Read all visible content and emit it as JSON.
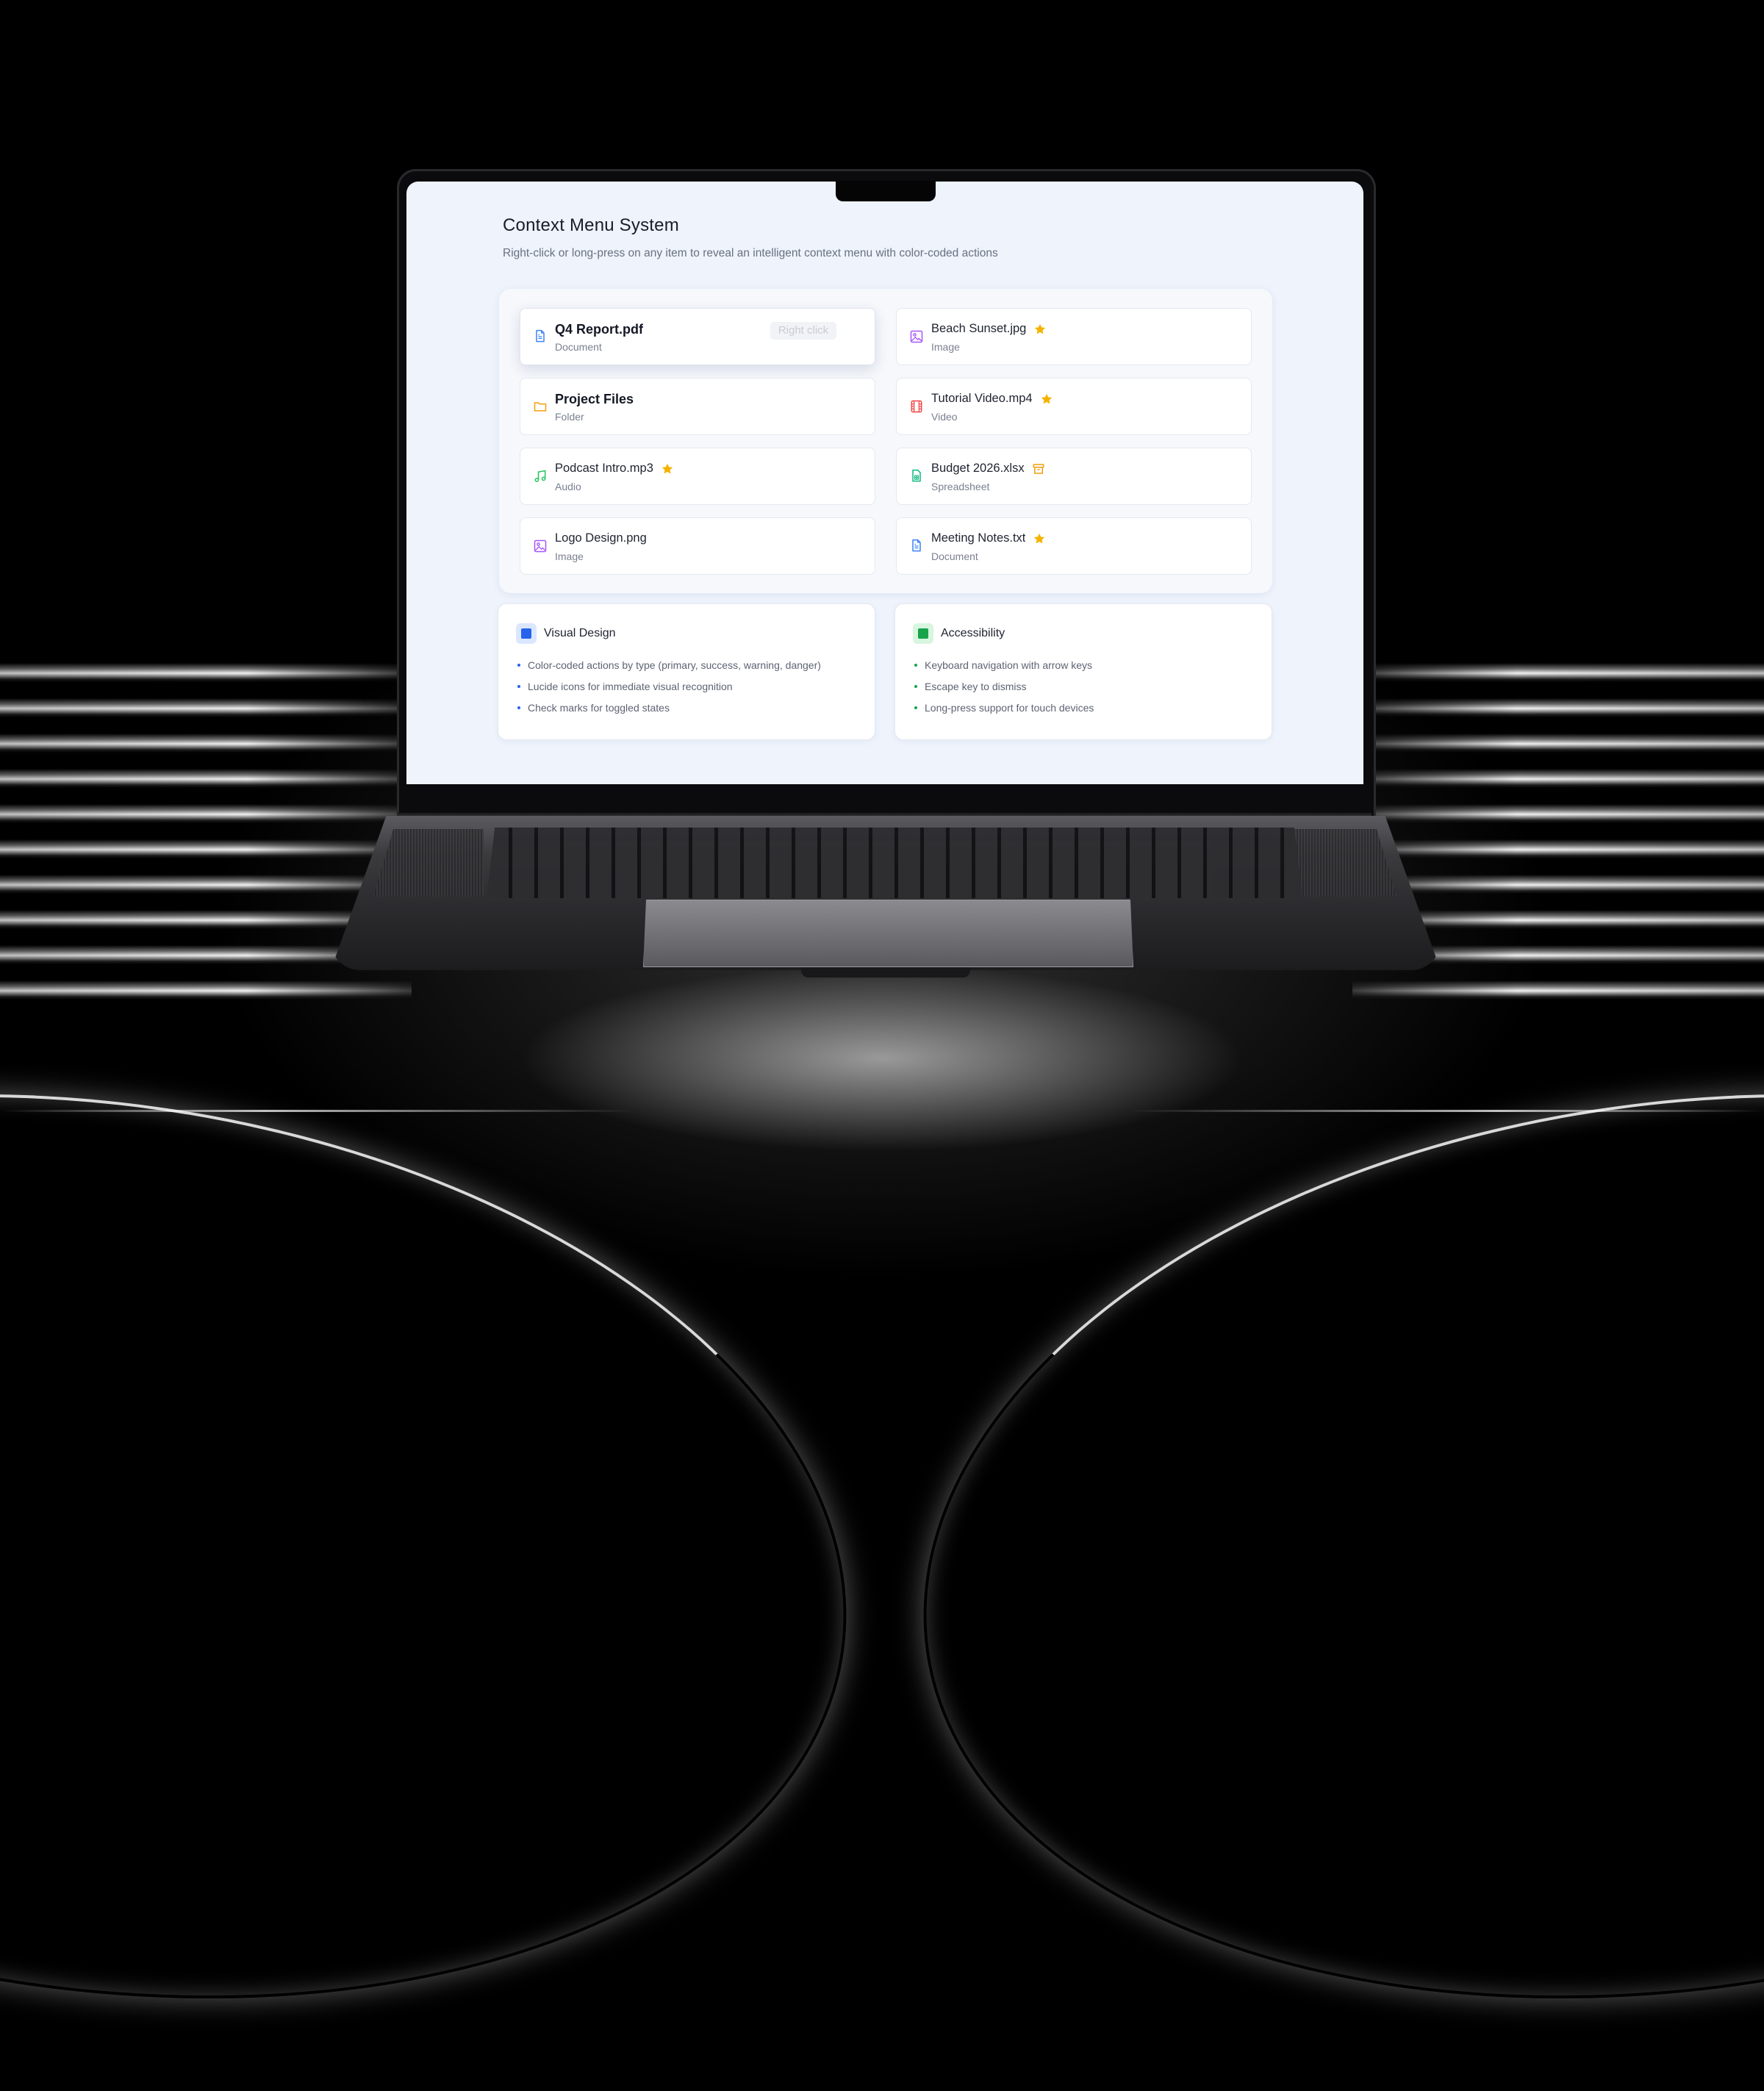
{
  "app": {
    "title": "Context Menu System",
    "subtitle": "Right-click or long-press on any item to reveal an intelligent context menu with color-coded actions"
  },
  "files": [
    {
      "name": "Q4 Report.pdf",
      "type": "Document",
      "icon": "file-text-icon",
      "color": "#3b82f6",
      "starred": false,
      "archived": false,
      "active": true,
      "hint": "Right click"
    },
    {
      "name": "Beach Sunset.jpg",
      "type": "Image",
      "icon": "image-icon",
      "color": "#a855f7",
      "starred": true,
      "archived": false
    },
    {
      "name": "Project Files",
      "type": "Folder",
      "icon": "folder-icon",
      "color": "#f59e0b",
      "starred": false,
      "archived": false
    },
    {
      "name": "Tutorial Video.mp4",
      "type": "Video",
      "icon": "film-icon",
      "color": "#ef4444",
      "starred": true,
      "archived": false
    },
    {
      "name": "Podcast Intro.mp3",
      "type": "Audio",
      "icon": "music-icon",
      "color": "#22c55e",
      "starred": true,
      "archived": false
    },
    {
      "name": "Budget 2026.xlsx",
      "type": "Spreadsheet",
      "icon": "spreadsheet-icon",
      "color": "#10b981",
      "starred": false,
      "archived": true
    },
    {
      "name": "Logo Design.png",
      "type": "Image",
      "icon": "image-icon",
      "color": "#a855f7",
      "starred": false,
      "archived": false
    },
    {
      "name": "Meeting Notes.txt",
      "type": "Document",
      "icon": "file-text-icon",
      "color": "#3b82f6",
      "starred": true,
      "archived": false
    }
  ],
  "features": [
    {
      "title": "Visual Design",
      "accent": "#2563eb",
      "items": [
        "Color-coded actions by type (primary, success, warning, danger)",
        "Lucide icons for immediate visual recognition",
        "Check marks for toggled states"
      ]
    },
    {
      "title": "Accessibility",
      "accent": "#16a34a",
      "items": [
        "Keyboard navigation with arrow keys",
        "Escape key to dismiss",
        "Long-press support for touch devices"
      ]
    }
  ],
  "colors": {
    "star": "#f5b300",
    "archive": "#f59e0b",
    "screen_bg": "#eef3fc"
  }
}
